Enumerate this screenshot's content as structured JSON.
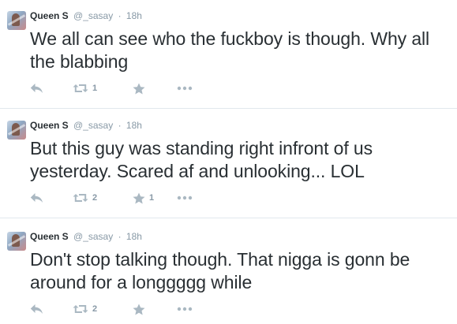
{
  "tweets": [
    {
      "name": "Queen S",
      "handle": "@_sasay",
      "separator": "·",
      "time": "18h",
      "text": "We all can see who the fuckboy is though. Why all the blabbing",
      "retweets": "1",
      "favorites": ""
    },
    {
      "name": "Queen S",
      "handle": "@_sasay",
      "separator": "·",
      "time": "18h",
      "text": "But this guy was standing right infront of us yesterday. Scared af and unlooking... LOL",
      "retweets": "2",
      "favorites": "1"
    },
    {
      "name": "Queen S",
      "handle": "@_sasay",
      "separator": "·",
      "time": "18h",
      "text": "Don't stop talking though. That nigga is gonn be around for a longgggg while",
      "retweets": "2",
      "favorites": ""
    }
  ],
  "icons": {
    "reply": "reply-icon",
    "retweet": "retweet-icon",
    "favorite": "star-icon",
    "more": "more-dots-icon"
  },
  "colors": {
    "text": "#292f33",
    "muted": "#8899a6",
    "icon": "#aab8c2",
    "divider": "#e1e8ed"
  }
}
